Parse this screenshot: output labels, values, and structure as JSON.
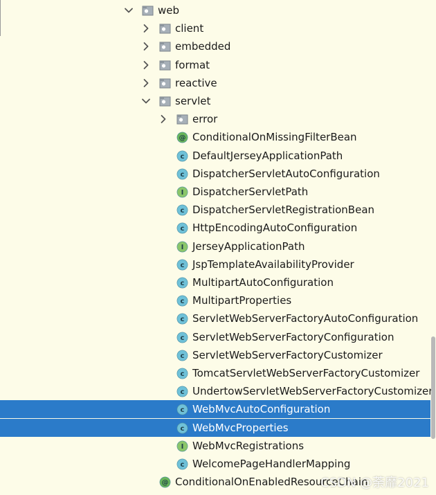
{
  "tree": {
    "items": [
      {
        "label": "web",
        "kind": "package",
        "expand": "open",
        "depth": 0
      },
      {
        "label": "client",
        "kind": "package",
        "expand": "closed",
        "depth": 1
      },
      {
        "label": "embedded",
        "kind": "package",
        "expand": "closed",
        "depth": 1
      },
      {
        "label": "format",
        "kind": "package",
        "expand": "closed",
        "depth": 1
      },
      {
        "label": "reactive",
        "kind": "package",
        "expand": "closed",
        "depth": 1
      },
      {
        "label": "servlet",
        "kind": "package",
        "expand": "open",
        "depth": 1
      },
      {
        "label": "error",
        "kind": "package",
        "expand": "closed",
        "depth": 2
      },
      {
        "label": "ConditionalOnMissingFilterBean",
        "kind": "annotation",
        "expand": "none",
        "depth": 2
      },
      {
        "label": "DefaultJerseyApplicationPath",
        "kind": "class",
        "expand": "none",
        "depth": 2
      },
      {
        "label": "DispatcherServletAutoConfiguration",
        "kind": "class",
        "expand": "none",
        "depth": 2
      },
      {
        "label": "DispatcherServletPath",
        "kind": "interface",
        "expand": "none",
        "depth": 2
      },
      {
        "label": "DispatcherServletRegistrationBean",
        "kind": "class",
        "expand": "none",
        "depth": 2
      },
      {
        "label": "HttpEncodingAutoConfiguration",
        "kind": "class",
        "expand": "none",
        "depth": 2
      },
      {
        "label": "JerseyApplicationPath",
        "kind": "interface",
        "expand": "none",
        "depth": 2
      },
      {
        "label": "JspTemplateAvailabilityProvider",
        "kind": "class",
        "expand": "none",
        "depth": 2
      },
      {
        "label": "MultipartAutoConfiguration",
        "kind": "class",
        "expand": "none",
        "depth": 2
      },
      {
        "label": "MultipartProperties",
        "kind": "class",
        "expand": "none",
        "depth": 2
      },
      {
        "label": "ServletWebServerFactoryAutoConfiguration",
        "kind": "class",
        "expand": "none",
        "depth": 2
      },
      {
        "label": "ServletWebServerFactoryConfiguration",
        "kind": "class",
        "expand": "none",
        "depth": 2
      },
      {
        "label": "ServletWebServerFactoryCustomizer",
        "kind": "class",
        "expand": "none",
        "depth": 2
      },
      {
        "label": "TomcatServletWebServerFactoryCustomizer",
        "kind": "class",
        "expand": "none",
        "depth": 2
      },
      {
        "label": "UndertowServletWebServerFactoryCustomizer",
        "kind": "class",
        "expand": "none",
        "depth": 2
      },
      {
        "label": "WebMvcAutoConfiguration",
        "kind": "class",
        "expand": "none",
        "depth": 2,
        "selected": true
      },
      {
        "label": "WebMvcProperties",
        "kind": "class",
        "expand": "none",
        "depth": 2,
        "selected": true
      },
      {
        "label": "WebMvcRegistrations",
        "kind": "interface",
        "expand": "none",
        "depth": 2
      },
      {
        "label": "WelcomePageHandlerMapping",
        "kind": "class",
        "expand": "none",
        "depth": 2
      },
      {
        "label": "ConditionalOnEnabledResourceChain",
        "kind": "annotation",
        "expand": "none",
        "depth": 1
      }
    ]
  },
  "watermark": "CSDN @荼靡2021",
  "colors": {
    "background": "#fdfce8",
    "selection": "#2b7bc9",
    "class_icon": "#6fc1d8",
    "interface_icon": "#8bc66a",
    "annotation_icon": "#6ab65a",
    "package_icon": "#9aa3ab"
  }
}
